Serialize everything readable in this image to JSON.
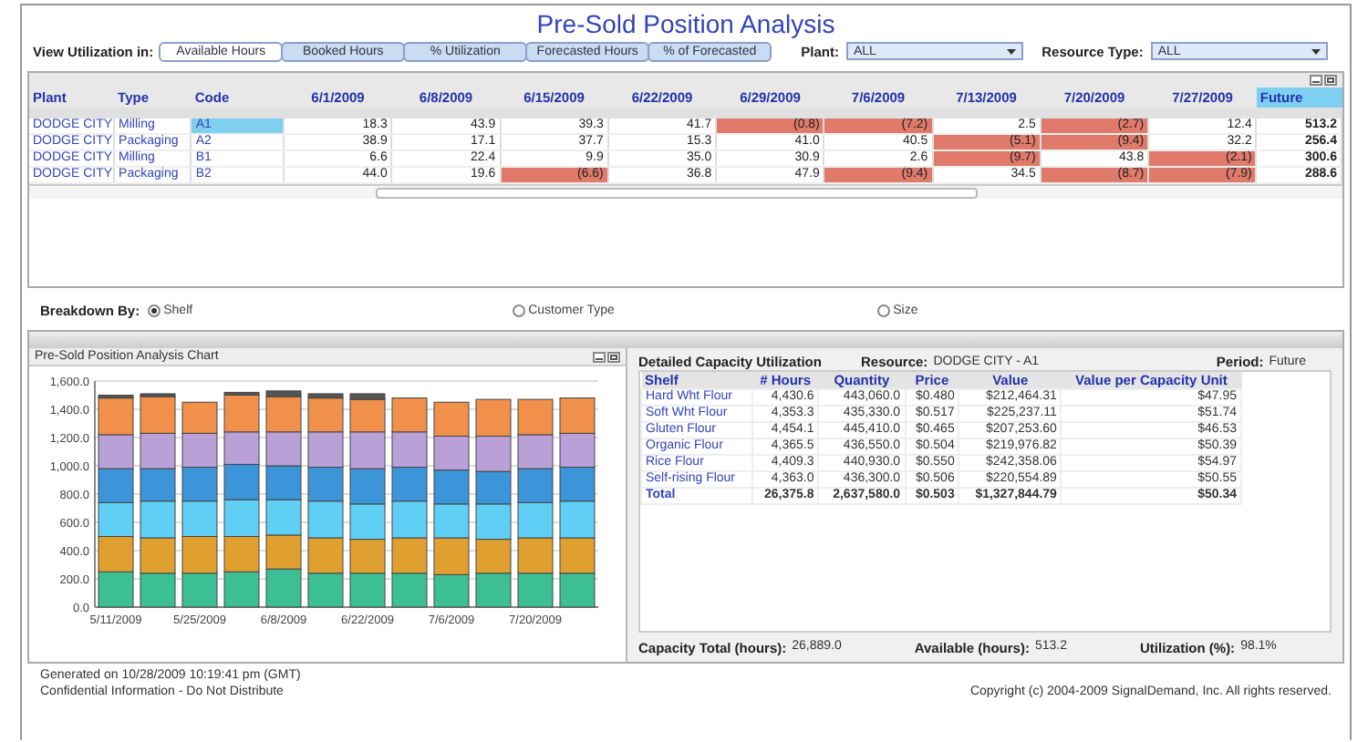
{
  "title": "Pre-Sold Position Analysis",
  "view_label": "View Utilization in:",
  "view_tabs": [
    {
      "label": "Available Hours",
      "selected": true
    },
    {
      "label": "Booked Hours",
      "selected": false
    },
    {
      "label": "% Utilization",
      "selected": false
    },
    {
      "label": "Forecasted Hours",
      "selected": false
    },
    {
      "label": "% of Forecasted",
      "selected": false
    }
  ],
  "filters": [
    {
      "label": "Plant:",
      "value": "ALL"
    },
    {
      "label": "Resource Type:",
      "value": "ALL"
    }
  ],
  "grid": {
    "columns": [
      "Plant",
      "Type",
      "Code",
      "6/1/2009",
      "6/8/2009",
      "6/15/2009",
      "6/22/2009",
      "6/29/2009",
      "7/6/2009",
      "7/13/2009",
      "7/20/2009",
      "7/27/2009",
      "Future"
    ],
    "rows": [
      {
        "selected": true,
        "cells": [
          {
            "text": "DODGE CITY",
            "flagged": false
          },
          {
            "text": "Milling",
            "flagged": false
          },
          {
            "text": "A1",
            "flagged": false
          },
          {
            "text": "18.3",
            "flagged": false
          },
          {
            "text": "43.9",
            "flagged": false
          },
          {
            "text": "39.3",
            "flagged": false
          },
          {
            "text": "41.7",
            "flagged": false
          },
          {
            "text": "(0.8)",
            "flagged": true
          },
          {
            "text": "(7.2)",
            "flagged": true
          },
          {
            "text": "2.5",
            "flagged": false
          },
          {
            "text": "(2.7)",
            "flagged": true
          },
          {
            "text": "12.4",
            "flagged": false
          },
          {
            "text": "513.2",
            "flagged": false
          }
        ]
      },
      {
        "selected": false,
        "cells": [
          {
            "text": "DODGE CITY",
            "flagged": false
          },
          {
            "text": "Packaging",
            "flagged": false
          },
          {
            "text": "A2",
            "flagged": false
          },
          {
            "text": "38.9",
            "flagged": false
          },
          {
            "text": "17.1",
            "flagged": false
          },
          {
            "text": "37.7",
            "flagged": false
          },
          {
            "text": "15.3",
            "flagged": false
          },
          {
            "text": "41.0",
            "flagged": false
          },
          {
            "text": "40.5",
            "flagged": false
          },
          {
            "text": "(5.1)",
            "flagged": true
          },
          {
            "text": "(9.4)",
            "flagged": true
          },
          {
            "text": "32.2",
            "flagged": false
          },
          {
            "text": "256.4",
            "flagged": false
          }
        ]
      },
      {
        "selected": false,
        "cells": [
          {
            "text": "DODGE CITY",
            "flagged": false
          },
          {
            "text": "Milling",
            "flagged": false
          },
          {
            "text": "B1",
            "flagged": false
          },
          {
            "text": "6.6",
            "flagged": false
          },
          {
            "text": "22.4",
            "flagged": false
          },
          {
            "text": "9.9",
            "flagged": false
          },
          {
            "text": "35.0",
            "flagged": false
          },
          {
            "text": "30.9",
            "flagged": false
          },
          {
            "text": "2.6",
            "flagged": false
          },
          {
            "text": "(9.7)",
            "flagged": true
          },
          {
            "text": "43.8",
            "flagged": false
          },
          {
            "text": "(2.1)",
            "flagged": true
          },
          {
            "text": "300.6",
            "flagged": false
          }
        ]
      },
      {
        "selected": false,
        "cells": [
          {
            "text": "DODGE CITY",
            "flagged": false
          },
          {
            "text": "Packaging",
            "flagged": false
          },
          {
            "text": "B2",
            "flagged": false
          },
          {
            "text": "44.0",
            "flagged": false
          },
          {
            "text": "19.6",
            "flagged": false
          },
          {
            "text": "(6.6)",
            "flagged": true
          },
          {
            "text": "36.8",
            "flagged": false
          },
          {
            "text": "47.9",
            "flagged": false
          },
          {
            "text": "(9.4)",
            "flagged": true
          },
          {
            "text": "34.5",
            "flagged": false
          },
          {
            "text": "(8.7)",
            "flagged": true
          },
          {
            "text": "(7.9)",
            "flagged": true
          },
          {
            "text": "288.6",
            "flagged": false
          }
        ]
      }
    ]
  },
  "breakdown": {
    "label": "Breakdown By:",
    "options": [
      {
        "label": "Shelf",
        "selected": true
      },
      {
        "label": "Customer Type",
        "selected": false
      },
      {
        "label": "Size",
        "selected": false
      }
    ]
  },
  "chart_panel": {
    "title": "Pre-Sold Position Analysis Chart",
    "chart_data": {
      "type": "bar",
      "stacked": true,
      "grid": true,
      "categories": [
        "5/11/2009",
        null,
        "5/25/2009",
        null,
        "6/8/2009",
        null,
        "6/22/2009",
        null,
        "7/6/2009",
        null,
        "7/20/2009",
        null
      ],
      "ylim": [
        0,
        1600
      ],
      "yticks": [
        {
          "value": 0,
          "label": "0.0"
        },
        {
          "value": 200,
          "label": "200.0"
        },
        {
          "value": 400,
          "label": "400.0"
        },
        {
          "value": 600,
          "label": "600.0"
        },
        {
          "value": 800,
          "label": "800.0"
        },
        {
          "value": 1000,
          "label": "1,000.0"
        },
        {
          "value": 1200,
          "label": "1,200.0"
        },
        {
          "value": 1400,
          "label": "1,400.0"
        },
        {
          "value": 1600,
          "label": "1,600.0"
        }
      ],
      "series": [
        {
          "color": "#3cbf94",
          "values": [
            250,
            240,
            240,
            250,
            270,
            240,
            240,
            240,
            230,
            240,
            240,
            240
          ]
        },
        {
          "color": "#e0a030",
          "values": [
            250,
            250,
            260,
            250,
            240,
            250,
            240,
            250,
            260,
            240,
            250,
            250
          ]
        },
        {
          "color": "#5fcff5",
          "values": [
            240,
            260,
            250,
            260,
            250,
            260,
            250,
            260,
            240,
            250,
            250,
            260
          ]
        },
        {
          "color": "#3c95d8",
          "values": [
            240,
            230,
            240,
            250,
            240,
            240,
            250,
            240,
            240,
            230,
            240,
            240
          ]
        },
        {
          "color": "#b9a1d8",
          "values": [
            240,
            250,
            240,
            230,
            240,
            250,
            260,
            250,
            240,
            250,
            240,
            240
          ]
        },
        {
          "color": "#f0904a",
          "values": [
            260,
            260,
            220,
            260,
            250,
            240,
            230,
            240,
            240,
            260,
            250,
            250
          ]
        },
        {
          "color": "#555555",
          "values": [
            20,
            20,
            0,
            20,
            40,
            30,
            40,
            0,
            0,
            0,
            0,
            0
          ]
        }
      ]
    }
  },
  "detail": {
    "title": "Detailed Capacity Utilization",
    "resource_label": "Resource:",
    "resource": "DODGE CITY -  A1",
    "period_label": "Period:",
    "period": "Future",
    "columns": [
      "Shelf",
      "# Hours",
      "Quantity",
      "Price",
      "Value",
      "Value per Capacity Unit"
    ],
    "rows": [
      [
        "Hard Wht Flour",
        "4,430.6",
        "443,060.0",
        "$0.480",
        "$212,464.31",
        "$47.95"
      ],
      [
        "Soft Wht Flour",
        "4,353.3",
        "435,330.0",
        "$0.517",
        "$225,237.11",
        "$51.74"
      ],
      [
        "Gluten Flour",
        "4,454.1",
        "445,410.0",
        "$0.465",
        "$207,253.60",
        "$46.53"
      ],
      [
        "Organic Flour",
        "4,365.5",
        "436,550.0",
        "$0.504",
        "$219,976.82",
        "$50.39"
      ],
      [
        "Rice Flour",
        "4,409.3",
        "440,930.0",
        "$0.550",
        "$242,358.06",
        "$54.97"
      ],
      [
        "Self-rising Flour",
        "4,363.0",
        "436,300.0",
        "$0.506",
        "$220,554.89",
        "$50.55"
      ]
    ],
    "total": [
      "Total",
      "26,375.8",
      "2,637,580.0",
      "$0.503",
      "$1,327,844.79",
      "$50.34"
    ],
    "summary": [
      {
        "label": "Capacity Total (hours):",
        "value": "26,889.0"
      },
      {
        "label": "Available (hours):",
        "value": "513.2"
      },
      {
        "label": "Utilization (%):",
        "value": "98.1%"
      }
    ]
  },
  "footer": {
    "generated": "Generated on 10/28/2009 10:19:41 pm (GMT)",
    "confidential": "Confidential Information - Do Not Distribute",
    "copyright": "Copyright (c) 2004-2009 SignalDemand, Inc. All rights reserved."
  }
}
